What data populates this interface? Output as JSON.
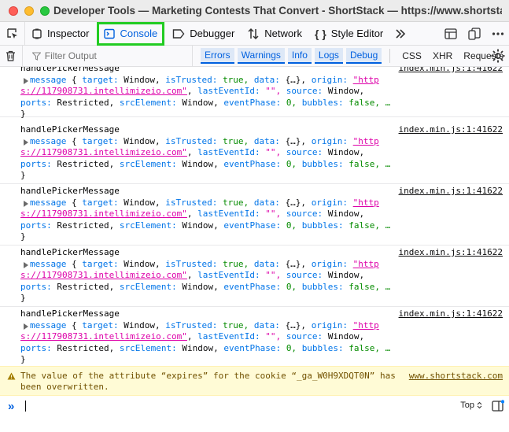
{
  "window": {
    "title": "Developer Tools — Marketing Contests That Convert - ShortStack — https://www.shortstack.com"
  },
  "tabs": [
    {
      "label": "Inspector",
      "icon": "inspector-icon"
    },
    {
      "label": "Console",
      "icon": "console-icon",
      "active": true
    },
    {
      "label": "Debugger",
      "icon": "debugger-icon"
    },
    {
      "label": "Network",
      "icon": "network-icon"
    },
    {
      "label": "Style Editor",
      "icon": "style-editor-icon"
    }
  ],
  "filter": {
    "placeholder": "Filter Output",
    "levels": [
      "Errors",
      "Warnings",
      "Info",
      "Logs",
      "Debug"
    ],
    "requests": [
      "CSS",
      "XHR",
      "Requests"
    ]
  },
  "messages": [
    {
      "title": "handlePickerMessage",
      "source": "index.min.js:1:41622",
      "kw_message": "message",
      "target_key": "target:",
      "target_val": "Window,",
      "trusted_key": "isTrusted:",
      "trusted_val": "true,",
      "data_key": "data:",
      "data_val": "{…},",
      "origin_key": "origin:",
      "origin_val_a": "\"http",
      "origin_val_b": "s://117908731.intellimizeio.com\"",
      "lei_key": "lastEventId:",
      "lei_val": "\"\",",
      "source_key": "source:",
      "source_val": "Window,",
      "ports_key": "ports:",
      "ports_val": "Restricted,",
      "src_key": "srcElement:",
      "src_val": "Window,",
      "phase_key": "eventPhase:",
      "phase_val": "0,",
      "bubbles_key": "bubbles:",
      "bubbles_val": "false, …"
    }
  ],
  "warning": {
    "text": "The value of the attribute “expires” for the cookie “_ga_W0H9XDQT0N” has been overwritten.",
    "source": "www.shortstack.com"
  },
  "input": {
    "prompt": "»",
    "context": "Top"
  },
  "colors": {
    "accent": "#0060df",
    "highlight_border": "#22cc22",
    "string": "#dd00a9",
    "number": "#058b00",
    "warning_bg": "#fffbd6"
  }
}
